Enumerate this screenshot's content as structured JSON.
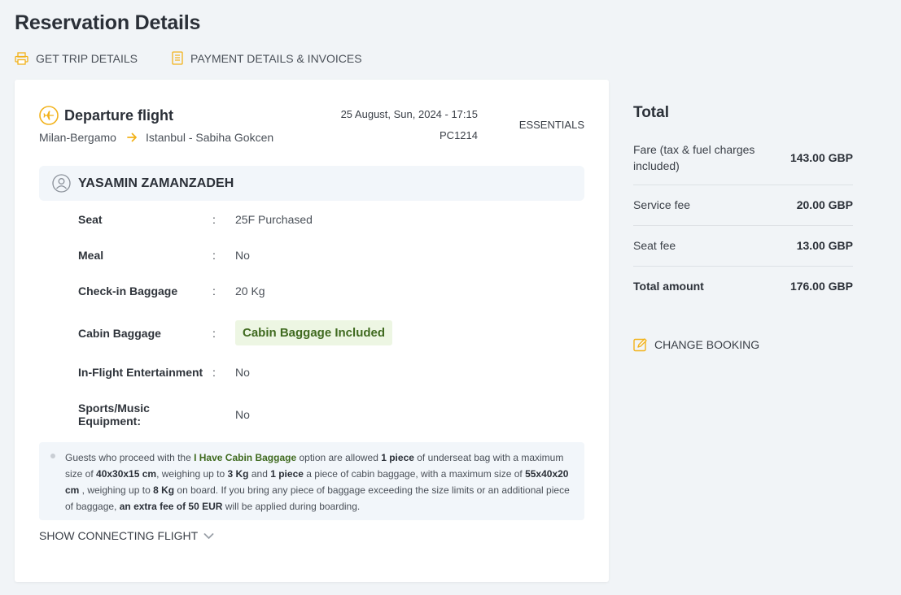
{
  "page": {
    "title": "Reservation Details"
  },
  "top_links": [
    {
      "label": "GET TRIP DETAILS",
      "icon": "printer-icon"
    },
    {
      "label": "PAYMENT DETAILS & INVOICES",
      "icon": "document-icon"
    }
  ],
  "flight": {
    "title": "Departure flight",
    "origin": "Milan-Bergamo",
    "destination": "Istanbul - Sabiha Gokcen",
    "datetime": "25 August, Sun, 2024 - 17:15",
    "flight_number": "PC1214",
    "fare_class": "ESSENTIALS"
  },
  "passenger": {
    "name": "YASAMIN ZAMANZADEH",
    "details": [
      {
        "label": "Seat",
        "colon": ":",
        "value": "25F Purchased"
      },
      {
        "label": "Meal",
        "colon": ":",
        "value": "No"
      },
      {
        "label": "Check-in Baggage",
        "colon": ":",
        "value": "20 Kg"
      },
      {
        "label": "Cabin Baggage",
        "colon": ":",
        "value": "Cabin Baggage Included"
      },
      {
        "label": "In-Flight Entertainment",
        "colon": ":",
        "value": "No"
      },
      {
        "label": "Sports/Music Equipment:",
        "colon": "",
        "value": "No"
      }
    ]
  },
  "info": {
    "t1": "Guests who proceed with the ",
    "b1": "I Have Cabin Baggage",
    "t2": " option are allowed ",
    "b2": "1 piece",
    "t3": " of underseat bag with a maximum size of ",
    "b3": "40x30x15 cm",
    "t4": ", weighing up to ",
    "b4": "3 Kg",
    "t5": " and ",
    "b5": "1 piece",
    "t6": " a piece of cabin baggage, with a maximum size of ",
    "b6": "55x40x20 cm",
    "t7": " , weighing up to ",
    "b7": "8 Kg",
    "t8": " on board. If you bring any piece of baggage exceeding the size limits or an additional piece of baggage, ",
    "b8": "an extra fee of 50 EUR",
    "t9": " will be applied during boarding."
  },
  "show_connecting": "SHOW CONNECTING FLIGHT",
  "totals": {
    "title": "Total",
    "rows": [
      {
        "label": "Fare (tax & fuel charges included)",
        "value": "143.00 GBP"
      },
      {
        "label": "Service fee",
        "value": "20.00 GBP"
      },
      {
        "label": "Seat fee",
        "value": "13.00 GBP"
      },
      {
        "label": "Total amount",
        "value": "176.00 GBP"
      }
    ]
  },
  "change_booking": "CHANGE BOOKING",
  "colors": {
    "accent": "#f2b21b",
    "green_text": "#3f6a1f",
    "green_bg": "#edf6e3"
  }
}
